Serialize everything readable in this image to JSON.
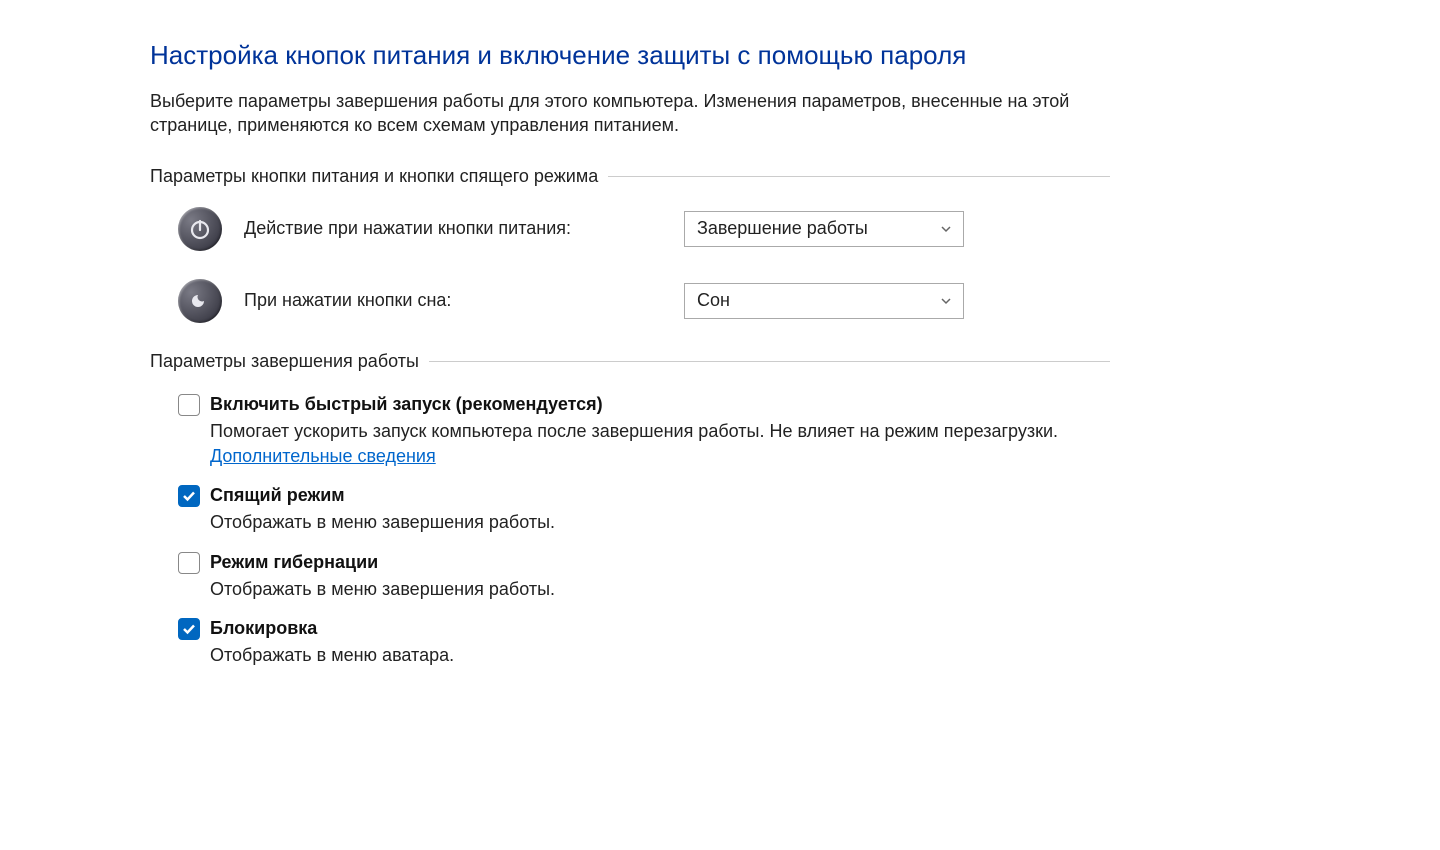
{
  "header": {
    "title": "Настройка кнопок питания и включение защиты с помощью пароля",
    "description": "Выберите параметры завершения работы для этого компьютера. Изменения параметров, внесенные на этой странице, применяются ко всем схемам управления питанием."
  },
  "section_buttons": {
    "title": "Параметры кнопки питания и кнопки спящего режима",
    "power_button": {
      "label": "Действие при нажатии кнопки питания:",
      "value": "Завершение работы"
    },
    "sleep_button": {
      "label": "При нажатии кнопки сна:",
      "value": "Сон"
    }
  },
  "section_shutdown": {
    "title": "Параметры завершения работы",
    "items": [
      {
        "checked": false,
        "label": "Включить быстрый запуск (рекомендуется)",
        "desc": "Помогает ускорить запуск компьютера после завершения работы. Не влияет на режим перезагрузки. ",
        "link": "Дополнительные сведения"
      },
      {
        "checked": true,
        "label": "Спящий режим",
        "desc": "Отображать в меню завершения работы."
      },
      {
        "checked": false,
        "label": "Режим гибернации",
        "desc": "Отображать в меню завершения работы."
      },
      {
        "checked": true,
        "label": "Блокировка",
        "desc": "Отображать в меню аватара."
      }
    ]
  }
}
